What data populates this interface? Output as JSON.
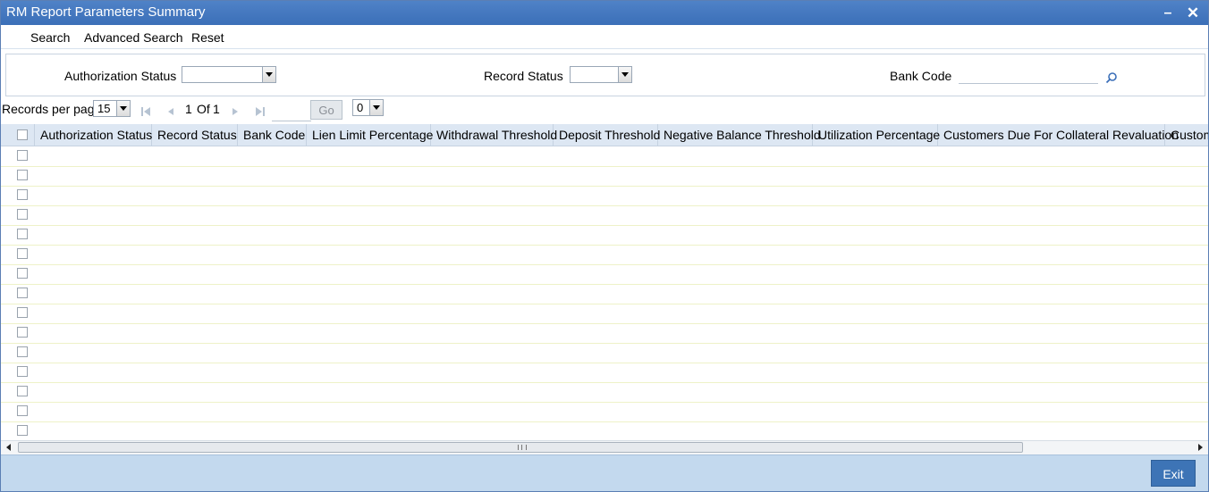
{
  "window": {
    "title": "RM Report Parameters Summary"
  },
  "toolbar": {
    "search_label": "Search",
    "advanced_search_label": "Advanced Search",
    "reset_label": "Reset"
  },
  "search": {
    "authorization_status_label": "Authorization Status",
    "authorization_status_value": "",
    "record_status_label": "Record Status",
    "record_status_value": "",
    "bank_code_label": "Bank Code",
    "bank_code_value": ""
  },
  "pager": {
    "records_per_page_label": "Records per page",
    "records_per_page_value": "15",
    "current_page": "1",
    "of_label": "Of",
    "total_pages": "1",
    "go_label": "Go",
    "page_select_value": "0"
  },
  "grid": {
    "columns": [
      "Authorization Status",
      "Record Status",
      "Bank Code",
      "Lien Limit Percentage",
      "Withdrawal Threshold",
      "Deposit Threshold",
      "Negative Balance Threshold",
      "Utilization Percentage",
      "Customers Due For Collateral Revaluation",
      "Custom"
    ],
    "row_count": 15
  },
  "footer": {
    "exit_label": "Exit"
  },
  "colors": {
    "titlebar": "#3b6fb8",
    "header_bg": "#dde7f3",
    "footer_bg": "#c3d9ee",
    "exit_button": "#3d74b6"
  },
  "icons": {
    "search_field": "search-icon",
    "first_page": "first-page-icon",
    "prev_page": "prev-page-icon",
    "next_page": "next-page-icon",
    "last_page": "last-page-icon"
  }
}
